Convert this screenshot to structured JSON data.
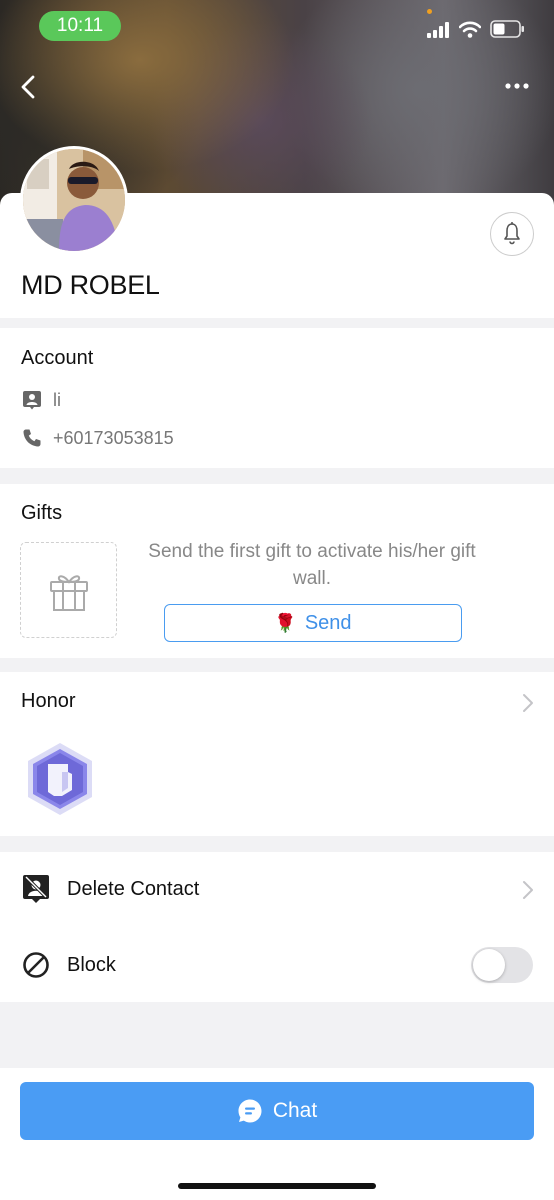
{
  "status_bar": {
    "time": "10:11"
  },
  "profile": {
    "name": "MD ROBEL"
  },
  "account": {
    "title": "Account",
    "user_id": "li",
    "phone": "+60173053815"
  },
  "gifts": {
    "title": "Gifts",
    "message": "Send the first gift to activate his/her gift wall.",
    "send_label": "Send"
  },
  "honor": {
    "title": "Honor"
  },
  "actions": {
    "delete_label": "Delete Contact",
    "block_label": "Block",
    "block_enabled": false
  },
  "footer": {
    "chat_label": "Chat"
  },
  "colors": {
    "accent": "#4a9cf4",
    "time_pill": "#5ac85a",
    "badge": "#7b78e0"
  },
  "icons": {
    "back": "chevron-left-icon",
    "more": "more-dots-icon",
    "bell": "bell-icon",
    "id": "contact-card-icon",
    "phone": "phone-icon",
    "gift": "gift-icon",
    "rose": "rose-icon",
    "honor_badge": "honor-badge-icon",
    "delete": "delete-contact-icon",
    "block": "block-icon",
    "chat": "chat-bubble-icon"
  }
}
